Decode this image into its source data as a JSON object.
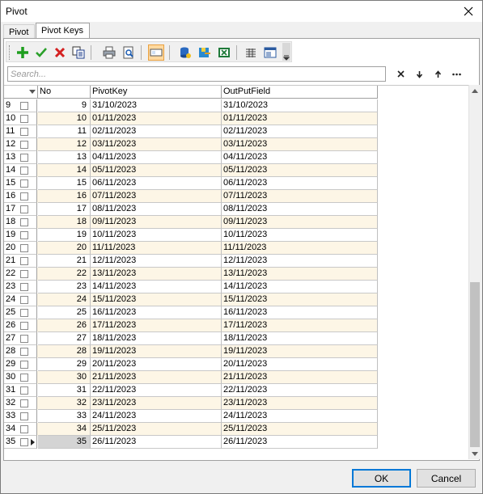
{
  "window": {
    "title": "Pivot"
  },
  "tabs": [
    {
      "label": "Pivot",
      "active": false
    },
    {
      "label": "Pivot Keys",
      "active": true
    }
  ],
  "toolbar": {
    "buttons": [
      {
        "icon": "add-icon"
      },
      {
        "icon": "check-icon"
      },
      {
        "icon": "delete-icon"
      },
      {
        "icon": "copy-icon"
      },
      {
        "icon": "print-icon"
      },
      {
        "icon": "print-preview-icon"
      },
      {
        "icon": "toggle-view-icon",
        "pressed": true
      },
      {
        "icon": "import-icon"
      },
      {
        "icon": "export-icon"
      },
      {
        "icon": "excel-icon"
      },
      {
        "icon": "columns-icon"
      },
      {
        "icon": "layout-icon"
      }
    ]
  },
  "search": {
    "placeholder": "Search...",
    "value": ""
  },
  "grid": {
    "columns": [
      "No",
      "PivotKey",
      "OutPutField"
    ],
    "rows": [
      {
        "row": "9",
        "no": "9",
        "key": "31/10/2023",
        "out": "31/10/2023"
      },
      {
        "row": "10",
        "no": "10",
        "key": "01/11/2023",
        "out": "01/11/2023"
      },
      {
        "row": "11",
        "no": "11",
        "key": "02/11/2023",
        "out": "02/11/2023"
      },
      {
        "row": "12",
        "no": "12",
        "key": "03/11/2023",
        "out": "03/11/2023"
      },
      {
        "row": "13",
        "no": "13",
        "key": "04/11/2023",
        "out": "04/11/2023"
      },
      {
        "row": "14",
        "no": "14",
        "key": "05/11/2023",
        "out": "05/11/2023"
      },
      {
        "row": "15",
        "no": "15",
        "key": "06/11/2023",
        "out": "06/11/2023"
      },
      {
        "row": "16",
        "no": "16",
        "key": "07/11/2023",
        "out": "07/11/2023"
      },
      {
        "row": "17",
        "no": "17",
        "key": "08/11/2023",
        "out": "08/11/2023"
      },
      {
        "row": "18",
        "no": "18",
        "key": "09/11/2023",
        "out": "09/11/2023"
      },
      {
        "row": "19",
        "no": "19",
        "key": "10/11/2023",
        "out": "10/11/2023"
      },
      {
        "row": "20",
        "no": "20",
        "key": "11/11/2023",
        "out": "11/11/2023"
      },
      {
        "row": "21",
        "no": "21",
        "key": "12/11/2023",
        "out": "12/11/2023"
      },
      {
        "row": "22",
        "no": "22",
        "key": "13/11/2023",
        "out": "13/11/2023"
      },
      {
        "row": "23",
        "no": "23",
        "key": "14/11/2023",
        "out": "14/11/2023"
      },
      {
        "row": "24",
        "no": "24",
        "key": "15/11/2023",
        "out": "15/11/2023"
      },
      {
        "row": "25",
        "no": "25",
        "key": "16/11/2023",
        "out": "16/11/2023"
      },
      {
        "row": "26",
        "no": "26",
        "key": "17/11/2023",
        "out": "17/11/2023"
      },
      {
        "row": "27",
        "no": "27",
        "key": "18/11/2023",
        "out": "18/11/2023"
      },
      {
        "row": "28",
        "no": "28",
        "key": "19/11/2023",
        "out": "19/11/2023"
      },
      {
        "row": "29",
        "no": "29",
        "key": "20/11/2023",
        "out": "20/11/2023"
      },
      {
        "row": "30",
        "no": "30",
        "key": "21/11/2023",
        "out": "21/11/2023"
      },
      {
        "row": "31",
        "no": "31",
        "key": "22/11/2023",
        "out": "22/11/2023"
      },
      {
        "row": "32",
        "no": "32",
        "key": "23/11/2023",
        "out": "23/11/2023"
      },
      {
        "row": "33",
        "no": "33",
        "key": "24/11/2023",
        "out": "24/11/2023"
      },
      {
        "row": "34",
        "no": "34",
        "key": "25/11/2023",
        "out": "25/11/2023"
      },
      {
        "row": "35",
        "no": "35",
        "key": "26/11/2023",
        "out": "26/11/2023",
        "current": true
      }
    ]
  },
  "buttons": {
    "ok": "OK",
    "cancel": "Cancel"
  },
  "colors": {
    "alt_row": "#fdf6e6",
    "accent": "#0078d7"
  }
}
